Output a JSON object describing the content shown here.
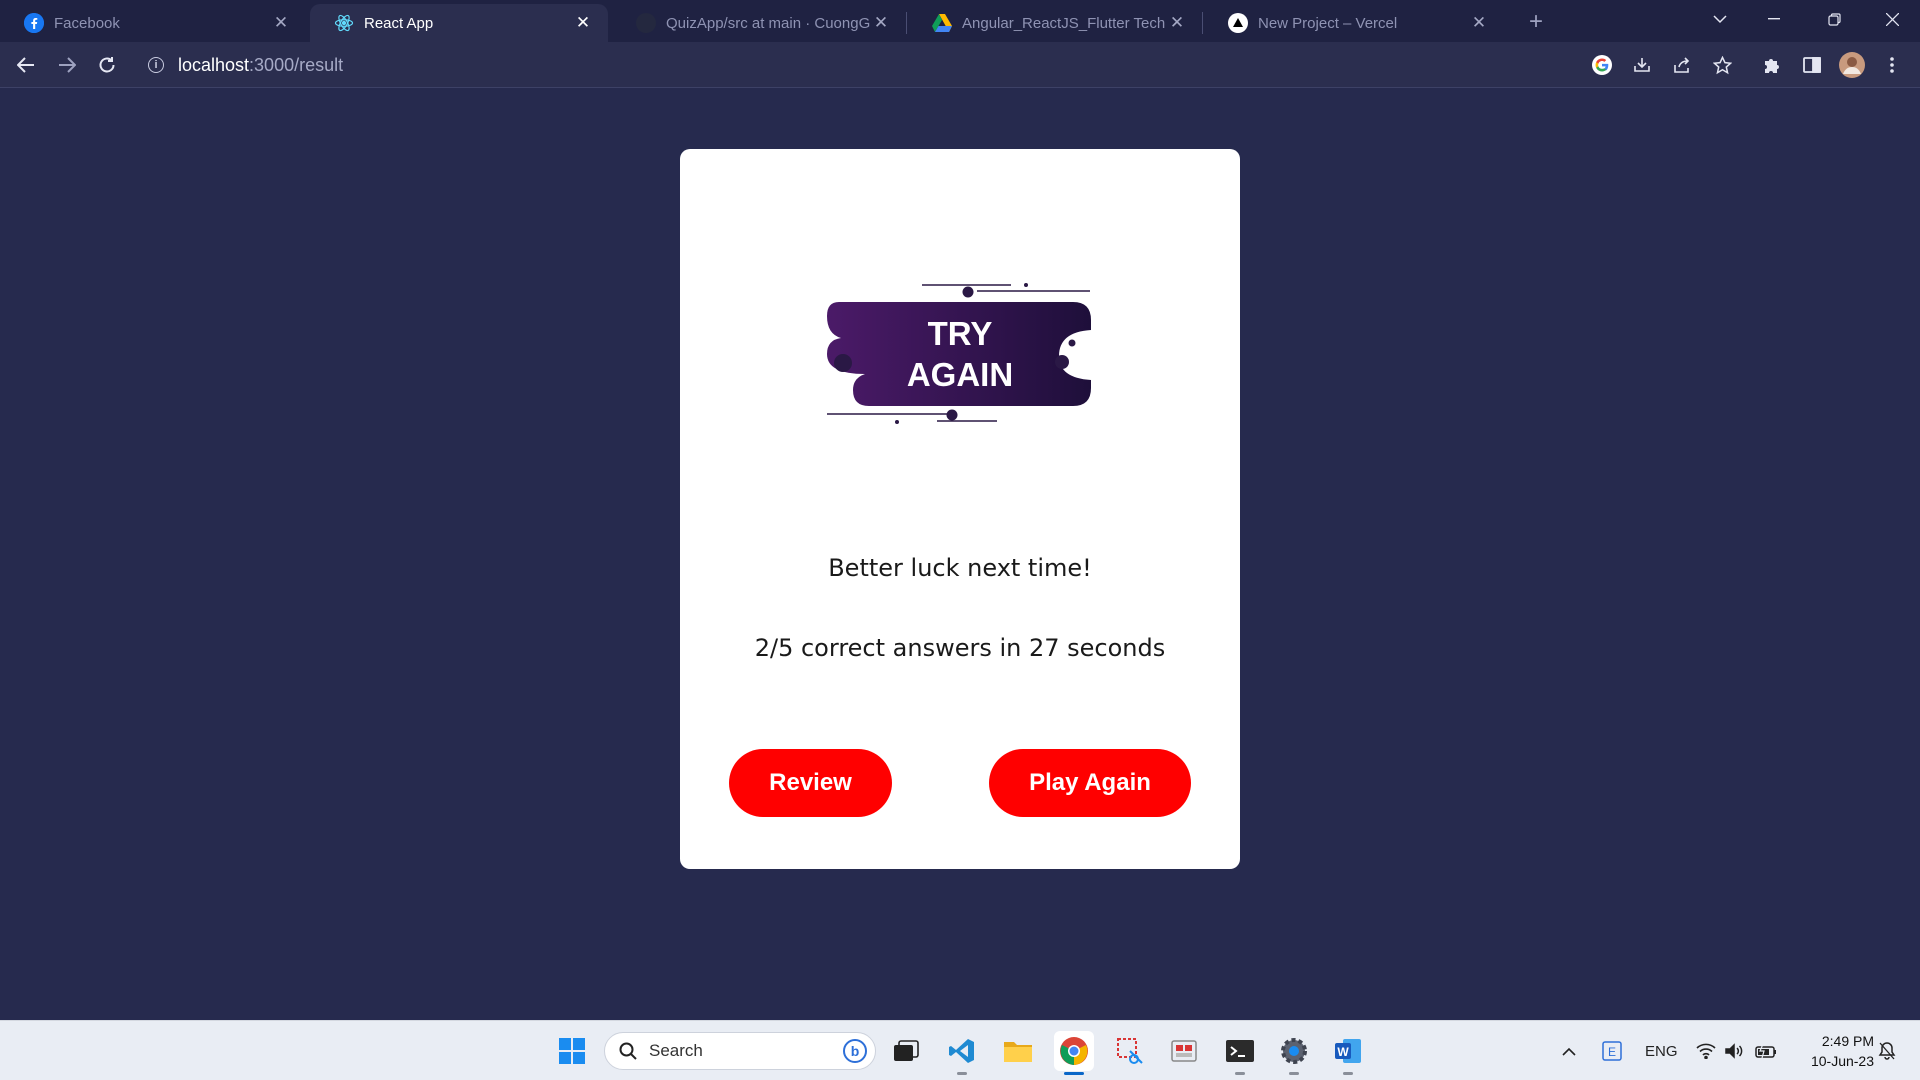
{
  "browser": {
    "tabs": [
      {
        "label": "Facebook",
        "icon": "facebook-icon",
        "active": false
      },
      {
        "label": "React App",
        "icon": "react-icon",
        "active": true
      },
      {
        "label": "QuizApp/src at main · CuongGo",
        "icon": "github-icon",
        "active": false
      },
      {
        "label": "Angular_ReactJS_Flutter Technica",
        "icon": "google-drive-icon",
        "active": false
      },
      {
        "label": "New Project – Vercel",
        "icon": "vercel-icon",
        "active": false
      }
    ],
    "url_host": "localhost",
    "url_path": ":3000/result"
  },
  "result": {
    "banner_line1": "TRY",
    "banner_line2": "AGAIN",
    "message": "Better luck next time!",
    "score": "2/5 correct answers in 27 seconds",
    "review_label": "Review",
    "play_again_label": "Play Again"
  },
  "taskbar": {
    "search_placeholder": "Search",
    "language": "ENG",
    "time": "2:49 PM",
    "date": "10-Jun-23"
  },
  "colors": {
    "page_bg": "#262a4e",
    "button": "#ff0000",
    "banner_gradient": [
      "#4b1a68",
      "#1e0f3a"
    ]
  }
}
